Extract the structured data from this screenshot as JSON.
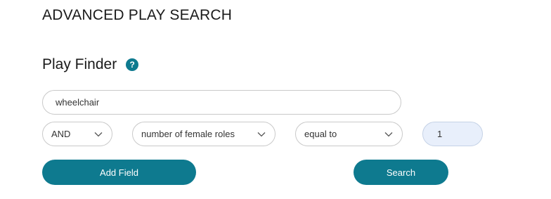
{
  "page": {
    "title": "ADVANCED PLAY SEARCH"
  },
  "finder": {
    "title": "Play Finder",
    "help_icon": "question-mark-icon",
    "help_glyph": "?"
  },
  "keyword": {
    "value": "wheelchair",
    "placeholder": ""
  },
  "criteria": {
    "operator": "AND",
    "field": "number of female roles",
    "comparison": "equal to",
    "value": "1",
    "chevron_icon": "chevron-down-icon"
  },
  "buttons": {
    "add_field": "Add Field",
    "search": "Search"
  },
  "colors": {
    "accent": "#0e7a8f",
    "value_field_bg": "#e8effb",
    "border": "#c9c9c9"
  }
}
